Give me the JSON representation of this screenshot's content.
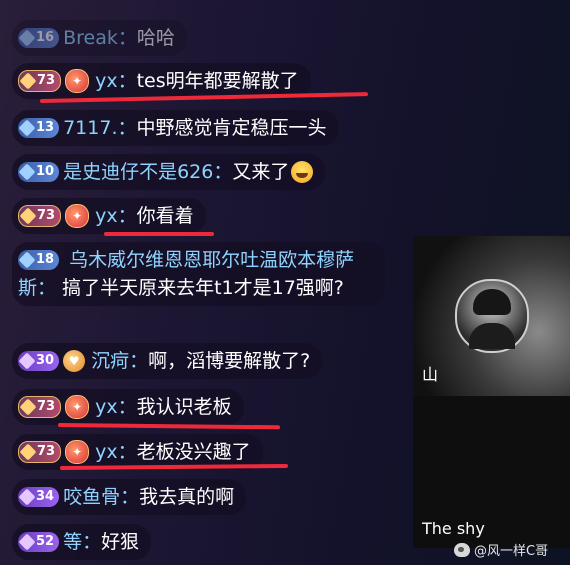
{
  "messages": [
    {
      "level": "16",
      "badge": "blue",
      "name": "Break：",
      "text": "哈哈",
      "faded": true
    },
    {
      "level": "73",
      "badge": "gold",
      "medal": "red",
      "name": "yx：",
      "text": "tes明年都要解散了"
    },
    {
      "level": "13",
      "badge": "blue",
      "name": "7117.：",
      "text": "中野感觉肯定稳压一头"
    },
    {
      "level": "10",
      "badge": "blue",
      "name": "是史迪仔不是626：",
      "text": "又来了"
    },
    {
      "level": "73",
      "badge": "gold",
      "medal": "red",
      "name": "yx：",
      "text": "你看着"
    },
    {
      "level": "18",
      "badge": "blue",
      "name": "乌木威尔维恩恩耶尔吐温欧本穆萨斯：",
      "text": "搞了半天原来去年t1才是17强啊?"
    },
    {
      "level": "30",
      "badge": "purple",
      "medal": "orange",
      "name": "沉疴：",
      "text": "啊，滔博要解散了?"
    },
    {
      "level": "73",
      "badge": "gold",
      "medal": "red",
      "name": "yx：",
      "text": "我认识老板"
    },
    {
      "level": "73",
      "badge": "gold",
      "medal": "red",
      "name": "yx：",
      "text": "老板没兴趣了"
    },
    {
      "level": "34",
      "badge": "purple",
      "name": "咬鱼骨：",
      "text": "我去真的啊"
    },
    {
      "level": "52",
      "badge": "purple",
      "name": "等：",
      "text": "好狠"
    }
  ],
  "video": {
    "char_label": "山",
    "player_name": "The shy"
  },
  "watermark": "@风一样C哥",
  "colors": {
    "name": "#8fd3ff",
    "underline": "#ee2a3a"
  }
}
